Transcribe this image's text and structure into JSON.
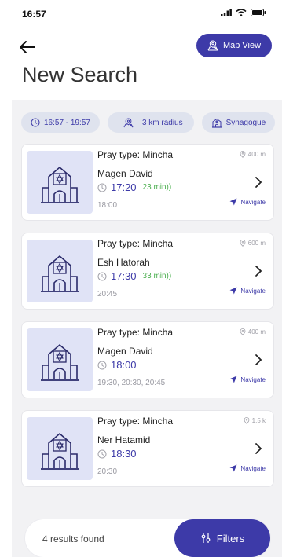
{
  "status_bar": {
    "time": "16:57"
  },
  "header": {
    "map_view_label": "Map View",
    "title": "New Search"
  },
  "filter_chips": [
    {
      "label": "16:57 - 19:57",
      "icon": "clock-icon"
    },
    {
      "label": "3 km radius",
      "icon": "map-pin-icon"
    },
    {
      "label": "Synagogue",
      "icon": "synagogue-icon"
    }
  ],
  "results": [
    {
      "pray_type": "Pray type: Mincha",
      "name": "Magen David",
      "time": "17:20",
      "relative": "23 min))",
      "other_times": "18:00",
      "distance": "400 m",
      "navigate_label": "Navigate"
    },
    {
      "pray_type": "Pray type: Mincha",
      "name": "Esh Hatorah",
      "time": "17:30",
      "relative": "33 min))",
      "other_times": "20:45",
      "distance": "600 m",
      "navigate_label": "Navigate"
    },
    {
      "pray_type": "Pray type: Mincha",
      "name": "Magen David",
      "time": "18:00",
      "relative": "",
      "other_times": "19:30, 20:30, 20:45",
      "distance": "400 m",
      "navigate_label": "Navigate"
    },
    {
      "pray_type": "Pray type: Mincha",
      "name": "Ner Hatamid",
      "time": "18:30",
      "relative": "",
      "other_times": "20:30",
      "distance": "1.5 k",
      "navigate_label": "Navigate"
    }
  ],
  "footer": {
    "results_text": "4 results found",
    "filters_label": "Filters"
  },
  "colors": {
    "accent": "#3d3aa8",
    "relative_time": "#4caf50",
    "chip_bg": "#dfe3ee",
    "thumb_bg": "#e0e3f6"
  }
}
